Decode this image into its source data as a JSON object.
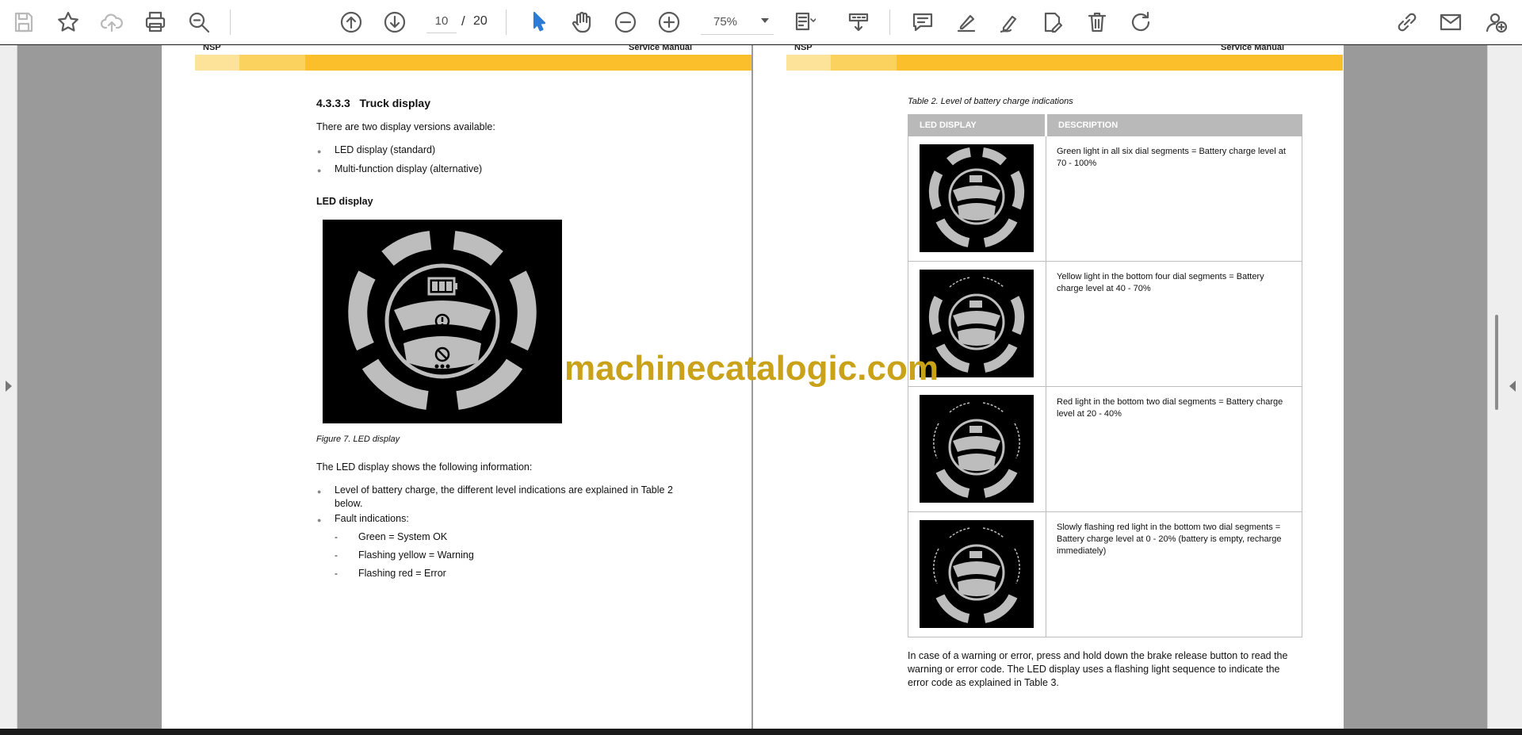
{
  "toolbar": {
    "page_current": "10",
    "page_separator": "/",
    "page_total": "20",
    "zoom": "75%"
  },
  "left_page": {
    "header_left": "NSP",
    "header_right": "Service Manual",
    "section_number": "4.3.3.3",
    "section_title": "Truck display",
    "intro": "There are two display versions available:",
    "versions": [
      "LED display (standard)",
      "Multi-function display (alternative)"
    ],
    "led_heading": "LED display",
    "figure_caption": "Figure 7. LED display",
    "info_intro": "The LED display shows the following information:",
    "info_item_1_line1": "Level of battery charge, the different level indications are explained in Table 2",
    "info_item_1_line2": "below.",
    "info_item_2": "Fault indications:",
    "faults": [
      {
        "dash": "-",
        "text": "Green = System OK"
      },
      {
        "dash": "-",
        "text": "Flashing yellow = Warning"
      },
      {
        "dash": "-",
        "text": "Flashing red = Error"
      }
    ]
  },
  "right_page": {
    "header_left": "NSP",
    "header_right": "Service Manual",
    "table_caption": "Table 2. Level of battery charge indications",
    "col_led": "LED DISPLAY",
    "col_desc": "DESCRIPTION",
    "rows": [
      {
        "lit_segments": 6,
        "description": "Green light in all six dial segments = Battery charge level at 70 - 100%"
      },
      {
        "lit_segments": 4,
        "description": "Yellow light in the bottom four dial segments = Battery charge level at 40 - 70%"
      },
      {
        "lit_segments": 2,
        "description": "Red light in the bottom two dial segments = Battery charge level at 20 - 40%"
      },
      {
        "lit_segments": 2,
        "description": "Slowly flashing red light in the bottom two dial segments = Battery charge level at 0 - 20% (battery is empty, recharge immediately)"
      }
    ],
    "footer_line1": "In case of a warning or error, press and hold down the brake release button to read the",
    "footer_line2": "warning or error code. The LED display uses a flashing light sequence to indicate the",
    "footer_line3": "error code as explained in Table 3."
  },
  "watermark": "machinecatalogic.com",
  "colors": {
    "band_light": "#fde39a",
    "band_mid": "#fcd25f",
    "band_dark": "#fbbf2c",
    "watermark": "#c9a21a",
    "accent": "#2e7bd6"
  },
  "icons": [
    "save-icon",
    "bookmark-star-icon",
    "cloud-upload-icon",
    "print-icon",
    "find-zoom-icon",
    "page-up-icon",
    "page-down-icon",
    "select-cursor-icon",
    "hand-tool-icon",
    "zoom-out-icon",
    "zoom-in-icon",
    "fit-page-icon",
    "scroll-mode-icon",
    "comment-icon",
    "highlight-icon",
    "draw-icon",
    "sign-icon",
    "delete-icon",
    "rotate-icon",
    "share-link-icon",
    "email-icon",
    "account-icon"
  ]
}
